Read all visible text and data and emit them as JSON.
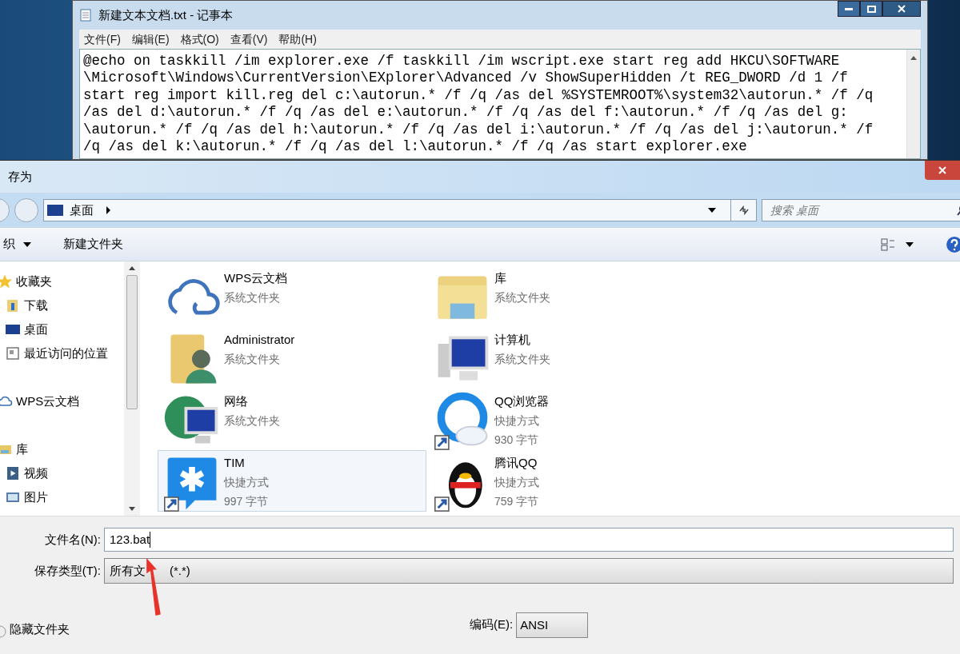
{
  "notepad": {
    "title": "新建文本文档.txt - 记事本",
    "menu": [
      "文件(F)",
      "编辑(E)",
      "格式(O)",
      "查看(V)",
      "帮助(H)"
    ],
    "lines": [
      "@echo on taskkill /im explorer.exe /f taskkill /im wscript.exe start reg add HKCU\\SOFTWARE",
      "\\Microsoft\\Windows\\CurrentVersion\\EXplorer\\Advanced /v ShowSuperHidden /t REG_DWORD /d 1 /f",
      "start reg import kill.reg del c:\\autorun.* /f /q /as del %SYSTEMROOT%\\system32\\autorun.* /f /q",
      "/as del d:\\autorun.* /f /q /as del e:\\autorun.* /f /q /as del f:\\autorun.* /f /q /as del g:",
      "\\autorun.* /f /q /as del h:\\autorun.* /f /q /as del i:\\autorun.* /f /q /as del j:\\autorun.* /f",
      "/q /as del k:\\autorun.* /f /q /as del l:\\autorun.* /f /q /as start explorer.exe"
    ]
  },
  "dialog": {
    "title": "存为",
    "breadcrumb": "桌面",
    "search": {
      "placeholder": "搜索 桌面"
    },
    "toolbar": [
      "织",
      "新建文件夹"
    ],
    "nav": [
      {
        "label": "收藏夹",
        "children": [
          {
            "label": "下载"
          },
          {
            "label": "桌面"
          },
          {
            "label": "最近访问的位置"
          }
        ]
      },
      {
        "label": "WPS云文档"
      },
      {
        "label": "库",
        "children": [
          {
            "label": "视频"
          },
          {
            "label": "图片"
          }
        ]
      }
    ],
    "items": [
      {
        "name": "WPS云文档",
        "details": [
          "系统文件夹"
        ],
        "selected": false
      },
      {
        "name": "库",
        "details": [
          "系统文件夹"
        ],
        "selected": false
      },
      {
        "name": "Administrator",
        "details": [
          "系统文件夹"
        ],
        "selected": false
      },
      {
        "name": "计算机",
        "details": [
          "系统文件夹"
        ],
        "selected": false
      },
      {
        "name": "网络",
        "details": [
          "系统文件夹"
        ],
        "selected": false
      },
      {
        "name": "QQ浏览器",
        "details": [
          "快捷方式",
          "930 字节"
        ],
        "selected": false
      },
      {
        "name": "TIM",
        "details": [
          "快捷方式",
          "997 字节"
        ],
        "selected": true
      },
      {
        "name": "腾讯QQ",
        "details": [
          "快捷方式",
          "759 字节"
        ],
        "selected": false
      }
    ],
    "filename": {
      "label": "文件名(N):",
      "value": "123.bat"
    },
    "filetype": {
      "label": "保存类型(T):",
      "value_start": "所有文",
      "value_end": "(*.*)"
    },
    "hide_folders": "隐藏文件夹",
    "encoding": {
      "label": "编码(E):",
      "value": "ANSI"
    }
  }
}
